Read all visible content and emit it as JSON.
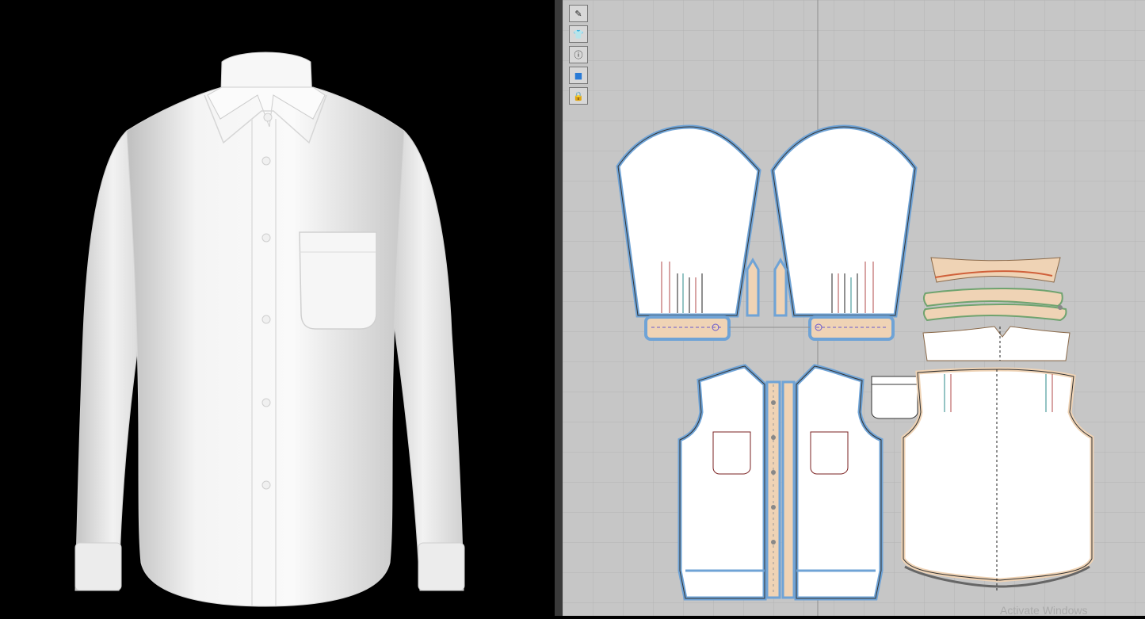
{
  "toolbar": {
    "tools": [
      {
        "icon": "pen-visibility-icon"
      },
      {
        "icon": "shirt-visibility-icon"
      },
      {
        "icon": "info-visibility-icon"
      },
      {
        "icon": "fabric-visibility-icon"
      },
      {
        "icon": "lock-garment-icon"
      }
    ]
  },
  "colors": {
    "viewport3d_background": "#000000",
    "viewport2d_background": "#c6c6c6",
    "grid_line": "#b4b4b4",
    "piece_fill": "#ffffff",
    "selection_outline": "#6fa3d6",
    "seam_allowance": "#efd3b5"
  },
  "watermark": {
    "text": "Activate Windows"
  }
}
